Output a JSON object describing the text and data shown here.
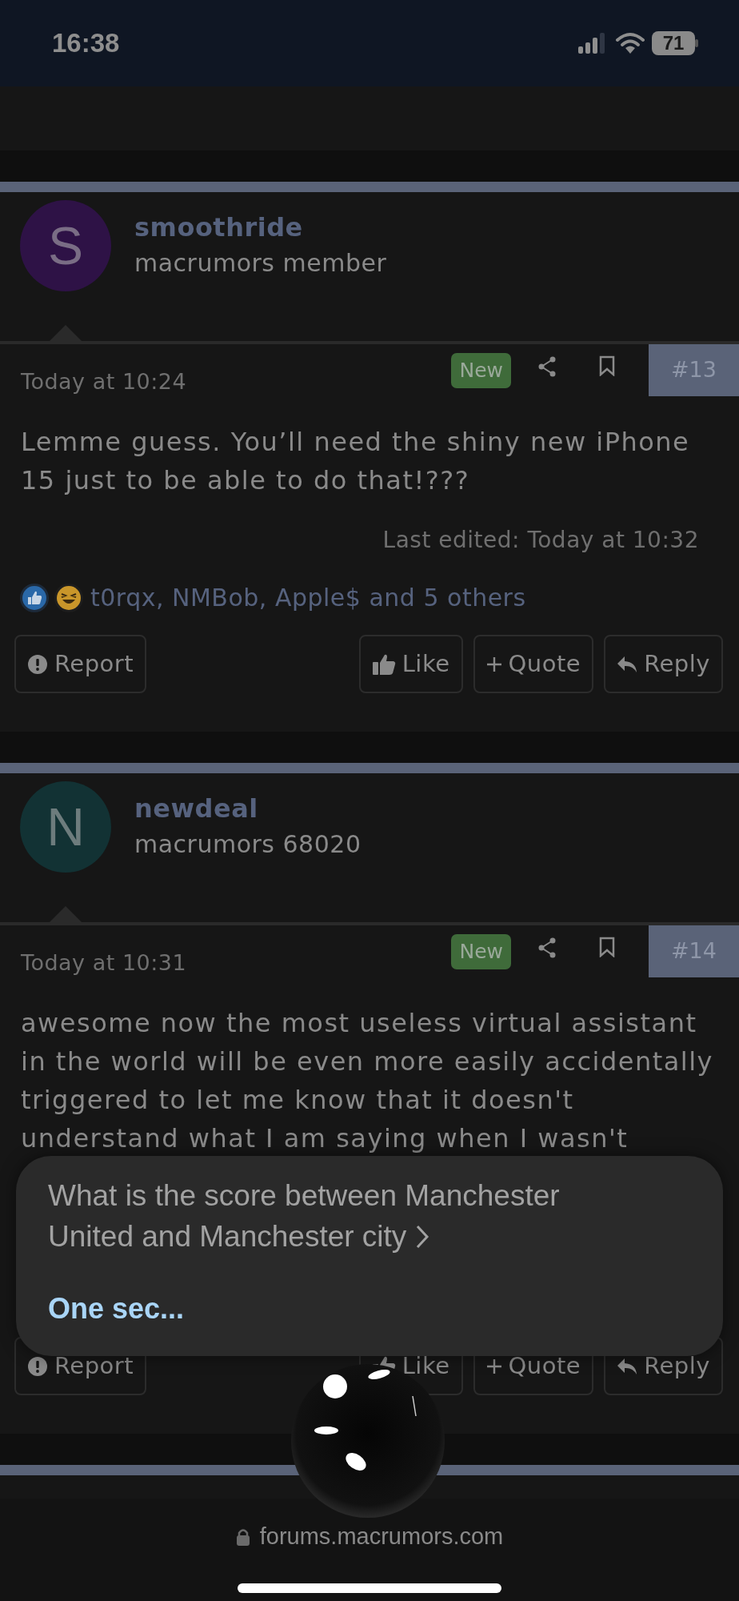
{
  "status_bar": {
    "time": "16:38",
    "battery": "71"
  },
  "posts": [
    {
      "author": "smoothride",
      "role": "macrumors member",
      "avatar": {
        "letter": "S",
        "color": "#2e1246"
      },
      "date": "Today at 10:24",
      "badge": "New",
      "number": "#13",
      "body": "Lemme guess. You’ll need the shiny new iPhone 15 just to be able to do that!???",
      "last_edited": "Last edited: Today at 10:32",
      "reactions": {
        "icons": [
          {
            "kind": "like"
          },
          {
            "kind": "laugh"
          }
        ],
        "names": "t0rqx, NMBob, Apple$ and 5 others"
      },
      "actions": [
        {
          "kind": "report",
          "label": "Report"
        },
        {
          "kind": "like",
          "label": "Like"
        },
        {
          "kind": "quote",
          "label": "Quote"
        },
        {
          "kind": "reply",
          "label": "Reply"
        }
      ]
    },
    {
      "author": "newdeal",
      "role": "macrumors 68020",
      "avatar": {
        "letter": "N",
        "color": "#123234"
      },
      "date": "Today at 10:31",
      "badge": "New",
      "number": "#14",
      "body": "awesome now the most useless virtual assistant in the world will be even more easily accidentally triggered to let me know that it doesn't understand what I am saying when I wasn't",
      "actions": [
        {
          "kind": "report",
          "label": "Report"
        },
        {
          "kind": "like",
          "label": "Like"
        },
        {
          "kind": "quote",
          "label": "Quote"
        },
        {
          "kind": "reply",
          "label": "Reply"
        }
      ]
    }
  ],
  "siri": {
    "query": "What is the score between Manchester United and Manchester city",
    "status": "One sec..."
  },
  "address_bar": {
    "url": "forums.macrumors.com"
  }
}
